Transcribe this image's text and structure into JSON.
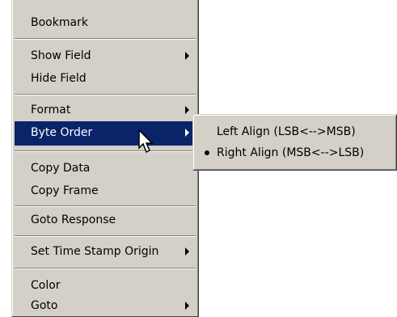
{
  "context_menu": {
    "items": [
      {
        "label": "Bookmark",
        "submenu": false
      },
      {
        "label": "Show Field",
        "submenu": true
      },
      {
        "label": "Hide Field",
        "submenu": false
      },
      {
        "label": "Format",
        "submenu": true
      },
      {
        "label": "Byte Order",
        "submenu": true,
        "highlighted": true
      },
      {
        "label": "Copy Data",
        "submenu": false
      },
      {
        "label": "Copy Frame",
        "submenu": false
      },
      {
        "label": "Goto Response",
        "submenu": false
      },
      {
        "label": "Set Time Stamp Origin",
        "submenu": true
      },
      {
        "label": "Color",
        "submenu": false
      },
      {
        "label": "Goto",
        "submenu": true
      }
    ]
  },
  "byte_order_submenu": {
    "items": [
      {
        "label": "Left Align (LSB<-->MSB)",
        "checked": false
      },
      {
        "label": "Right Align (MSB<-->LSB)",
        "checked": true
      }
    ]
  },
  "colors": {
    "menu_background": "#d4d0c8",
    "highlight_background": "#0a246a",
    "highlight_text": "#ffffff"
  },
  "icons": {
    "submenu_arrow": "triangle-right-icon",
    "radio_indicator": "radio-dot-icon",
    "mouse_pointer": "arrow-cursor-icon"
  }
}
